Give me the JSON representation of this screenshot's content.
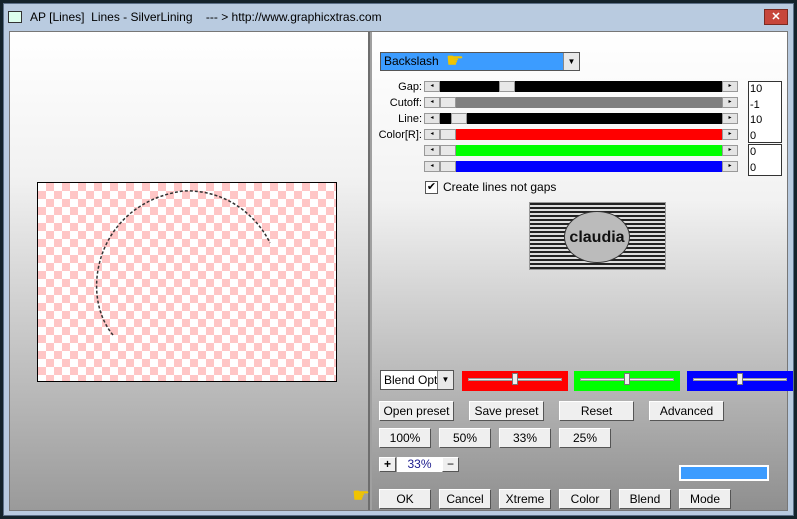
{
  "window": {
    "title": "AP [Lines]  Lines - SilverLining    --- > http://www.graphicxtras.com",
    "close_label": "✕"
  },
  "mode_select": {
    "value": "Backslash"
  },
  "sliders": [
    {
      "label": "Gap:",
      "value": "10",
      "fill": "#000000",
      "position": 0.22
    },
    {
      "label": "Cutoff:",
      "value": "-1",
      "fill": "#808080",
      "position": 0.0
    },
    {
      "label": "Line:",
      "value": "10",
      "fill": "#000000",
      "position": 0.04
    },
    {
      "label": "Color[R]:",
      "value": "0",
      "fill": "#ff0000",
      "position": 0.0
    },
    {
      "label": "",
      "value": "0",
      "fill": "#00ff00",
      "position": 0.0
    },
    {
      "label": "",
      "value": "0",
      "fill": "#0000ff",
      "position": 0.0
    }
  ],
  "checkbox": {
    "label": "Create lines not gaps",
    "checked": true
  },
  "logo": {
    "text": "claudia"
  },
  "blend_select": {
    "value": "Blend Opti"
  },
  "color_sliders": [
    {
      "color": "#ff0000",
      "position": 0.5
    },
    {
      "color": "#00ff00",
      "position": 0.5
    },
    {
      "color": "#0000ff",
      "position": 0.5
    }
  ],
  "buttons_row1": [
    "Open preset",
    "Save preset",
    "Reset",
    "Advanced"
  ],
  "zoom_buttons": [
    "100%",
    "50%",
    "33%",
    "25%"
  ],
  "zoom": {
    "plus": "+",
    "value": "33%",
    "minus": "−"
  },
  "swatch_color": "#3c9cff",
  "buttons_bottom": [
    "OK",
    "Cancel",
    "Xtreme",
    "Color",
    "Blend",
    "Mode"
  ]
}
